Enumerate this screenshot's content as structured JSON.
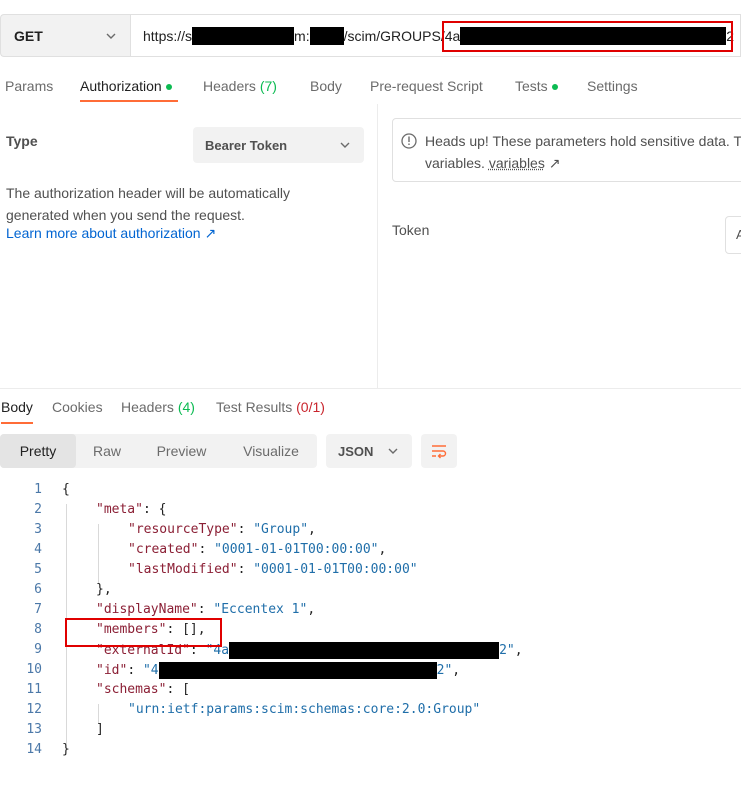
{
  "request": {
    "method": "GET",
    "url_start": "https://s",
    "url_mid1": "m:",
    "url_mid2": "/scim/GROUPS/4a",
    "url_end": "2"
  },
  "req_tabs": {
    "params": "Params",
    "authorization": "Authorization",
    "headers": "Headers",
    "headers_count": "(7)",
    "body": "Body",
    "prerequest": "Pre-request Script",
    "tests": "Tests",
    "settings": "Settings"
  },
  "auth": {
    "type_label": "Type",
    "type_value": "Bearer Token",
    "desc_line1": "The authorization header will be automatically",
    "desc_line2": "generated when you send the request.",
    "learn_more": "Learn more about authorization ↗",
    "notice_line1": "Heads up! These parameters hold sensitive data. T",
    "notice_line2": "variables.",
    "notice_link": "variables",
    "notice_arrow": "↗",
    "token_label": "Token",
    "token_value": "A"
  },
  "res_tabs": {
    "body": "Body",
    "cookies": "Cookies",
    "headers": "Headers",
    "headers_count": "(4)",
    "test_results": "Test Results",
    "test_count": "(0/1)"
  },
  "view": {
    "pretty": "Pretty",
    "raw": "Raw",
    "preview": "Preview",
    "visualize": "Visualize",
    "format": "JSON"
  },
  "code": {
    "line_numbers": [
      "1",
      "2",
      "3",
      "4",
      "5",
      "6",
      "7",
      "8",
      "9",
      "10",
      "11",
      "12",
      "13",
      "14"
    ],
    "open_brace": "{",
    "close_brace": "}",
    "meta_key": "\"meta\"",
    "meta_open": ": {",
    "resourceType_key": "\"resourceType\"",
    "resourceType_val": "\"Group\"",
    "created_key": "\"created\"",
    "created_val": "\"0001-01-01T00:00:00\"",
    "lastModified_key": "\"lastModified\"",
    "lastModified_val": "\"0001-01-01T00:00:00\"",
    "meta_close": "},",
    "displayName_key": "\"displayName\"",
    "displayName_val": "\"Eccentex 1\"",
    "members_key": "\"members\"",
    "members_val": ": [],",
    "externalId_key": "\"externalId\"",
    "externalId_val_start": "\"4a",
    "externalId_val_end": "2\"",
    "id_key": "\"id\"",
    "id_val_start": "\"4",
    "id_val_end": "2\"",
    "schemas_key": "\"schemas\"",
    "schemas_open": ": [",
    "schema_val": "\"urn:ietf:params:scim:schemas:core:2.0:Group\"",
    "schemas_close": "]",
    "comma": ",",
    "colon": ": "
  },
  "colors": {
    "accent": "#ff6c37",
    "green": "#0cbb52",
    "link": "#0265d2",
    "json_key": "#8b1f35",
    "json_string": "#1f6ea9",
    "highlight": "#e00000"
  }
}
